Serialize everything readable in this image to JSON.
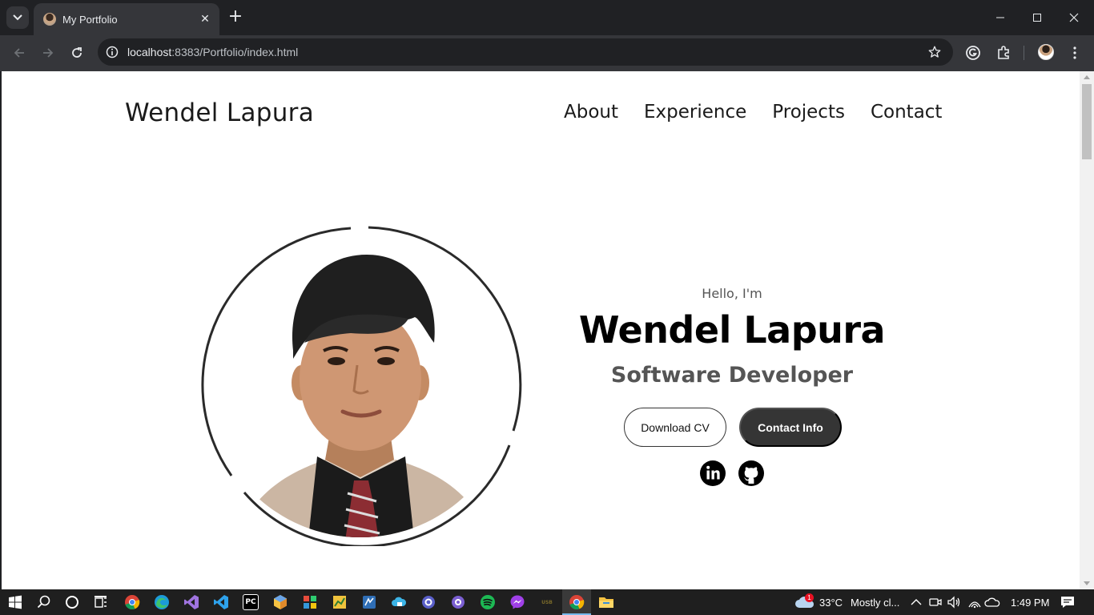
{
  "browser": {
    "tab_title": "My Portfolio",
    "tab_close": "✕",
    "new_tab": "+",
    "url_host": "localhost",
    "url_rest": ":8383/Portfolio/index.html"
  },
  "page": {
    "logo": "Wendel Lapura",
    "nav": [
      "About",
      "Experience",
      "Projects",
      "Contact"
    ],
    "hero": {
      "greeting": "Hello, I'm",
      "name": "Wendel Lapura",
      "role": "Software Developer",
      "buttons": {
        "download": "Download CV",
        "contact": "Contact Info"
      },
      "socials": [
        "linkedin-icon",
        "github-icon"
      ]
    }
  },
  "taskbar": {
    "weather_temp": "33°C",
    "weather_desc": "Mostly cl...",
    "weather_badge": "1",
    "time": "1:49 PM",
    "pinned": [
      "search",
      "cortana",
      "task-view",
      "chrome",
      "edge",
      "visual-studio",
      "vscode",
      "pycharm",
      "app-cube",
      "app-grid",
      "app-chart",
      "app-blue",
      "app-cloud",
      "app-gear",
      "app-github",
      "spotify",
      "messenger",
      "app-dark",
      "chrome-active",
      "file-explorer"
    ]
  },
  "colors": {
    "accent_dark": "#353535",
    "text_gray": "#555555",
    "page_bg": "#ffffff",
    "chrome_bg": "#202124"
  }
}
